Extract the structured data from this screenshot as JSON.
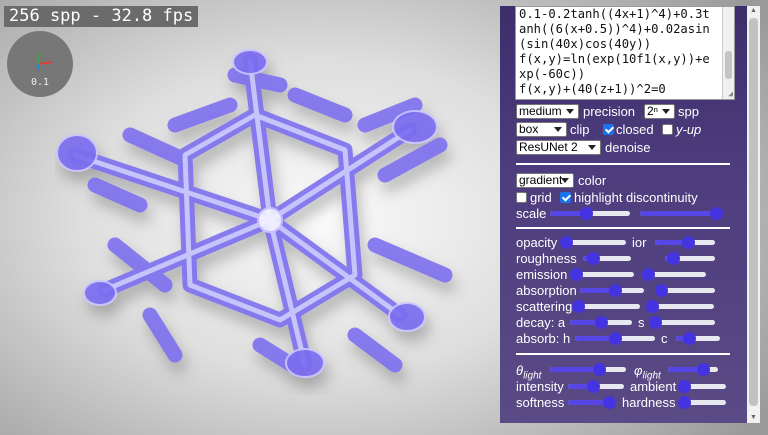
{
  "status": {
    "fps_text": "256 spp - 32.8 fps"
  },
  "gizmo": {
    "scale_label": "0.1",
    "x_color": "#e53935",
    "y_color": "#43a047",
    "z_color": "#1e88e5"
  },
  "equation": {
    "lines": [
      "0.1-0.2tanh((4x+1)^4)+0.3t",
      "anh((6(x+0.5))^4)+0.02asin",
      "(sin(40x)cos(40y))",
      "f(x,y)=ln(exp(10f1(x,y))+e",
      "xp(-60c))",
      "f(x,y)+(40(z+1))^2=0"
    ]
  },
  "render": {
    "precision": {
      "value": "medium",
      "label": "precision"
    },
    "spp": {
      "value": "2ⁿ",
      "label": "spp"
    }
  },
  "clip": {
    "value": "box",
    "label": "clip",
    "closed_label": "closed",
    "closed": true,
    "yup_label": "y-up",
    "yup": false
  },
  "denoise": {
    "value": "ResUNet 2",
    "label": "denoise"
  },
  "coloring": {
    "value": "gradient",
    "label": "color",
    "grid_label": "grid",
    "grid": false,
    "highlight_label": "highlight discontinuity",
    "highlight": true,
    "scale_label": "scale",
    "scale_a": 0.45,
    "scale_b": 0.95
  },
  "material": {
    "opacity_label": "opacity",
    "opacity": 0.0,
    "ior_label": "ior",
    "ior": 0.55,
    "roughness_label": "roughness",
    "roughness_a": 0.2,
    "roughness_b": 0.15,
    "emission_label": "emission",
    "emission_a": 0.0,
    "emission_b": 0.0,
    "absorption_label": "absorption",
    "absorption_a": 0.55,
    "absorption_b": 0.1,
    "scattering_label": "scattering",
    "scattering_a": 0.0,
    "scattering_b": 0.0,
    "decay_label": "decay: a",
    "decay_a": 0.5,
    "decay_s_label": "s",
    "decay_s": 0.0,
    "absorb_label": "absorb: h",
    "absorb_h": 0.5,
    "absorb_c_label": "c",
    "absorb_c": 0.3
  },
  "lighting": {
    "theta_symbol": "θ",
    "phi_symbol": "φ",
    "sub": "light",
    "theta": 0.65,
    "phi": 0.7,
    "intensity_label": "intensity",
    "intensity": 0.45,
    "ambient_label": "ambient",
    "ambient": 0.0,
    "softness_label": "softness",
    "softness": 0.85,
    "hardness_label": "hardness",
    "hardness": 0.0
  },
  "colors": {
    "panel": "#4a3a7a",
    "accent": "#4433e0",
    "object": "#6f5cf2"
  }
}
